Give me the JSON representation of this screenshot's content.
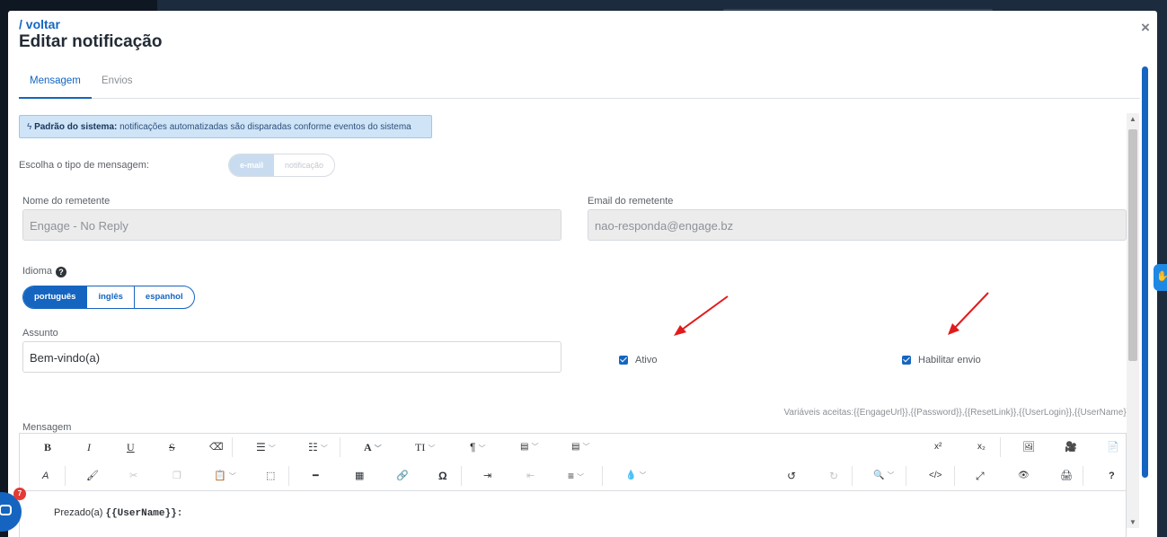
{
  "header": {
    "back_link": "/ voltar",
    "title": "Editar notificação",
    "close": "×"
  },
  "tabs": [
    {
      "label": "Mensagem",
      "active": true
    },
    {
      "label": "Envios",
      "active": false
    }
  ],
  "info": {
    "bold": "Padrão do sistema:",
    "text": " notificações automatizadas são disparadas conforme eventos do sistema"
  },
  "message_type": {
    "label": "Escolha o tipo de mensagem:",
    "options": [
      "e-mail",
      "notificação"
    ],
    "selected": "e-mail"
  },
  "sender": {
    "name_label": "Nome do remetente",
    "name_value": "Engage - No Reply",
    "email_label": "Email do remetente",
    "email_value": "nao-responda@engage.bz"
  },
  "language": {
    "label": "Idioma",
    "options": [
      "português",
      "inglês",
      "espanhol"
    ],
    "selected": "português"
  },
  "subject": {
    "label": "Assunto",
    "value": "Bem-vindo(a)"
  },
  "checkboxes": {
    "active_label": "Ativo",
    "active_checked": true,
    "enable_send_label": "Habilitar envio",
    "enable_send_checked": true
  },
  "variables": "Variáveis aceitas:{{EngageUrl}},{{Password}},{{ResetLink}},{{UserLogin}},{{UserName}}",
  "editor": {
    "label": "Mensagem",
    "body_prefix": "Prezado(a) ",
    "body_var": "{{UserName}}:",
    "toolbar_row1": [
      "B",
      "I",
      "U",
      "S",
      "⌫",
      "☰",
      "☷",
      "A",
      "TI",
      "¶",
      "▤",
      "▤",
      "x²",
      "x₂",
      "🖼",
      "🎥",
      "📄"
    ],
    "toolbar_row2": [
      "A",
      "🖌",
      "✂",
      "❐",
      "📋",
      "⬚",
      "━",
      "▦",
      "🔗",
      "Ω",
      "⇥",
      "⇤",
      "≡",
      "💧",
      "↺",
      "↻",
      "🔍",
      "</>",
      "⤢",
      "👁",
      "🖨",
      "?"
    ]
  },
  "chat": {
    "badge": "7"
  },
  "colors": {
    "primary": "#1565c0",
    "info_bg": "#cfe4f7",
    "annotation_arrow": "#e11b1b"
  }
}
